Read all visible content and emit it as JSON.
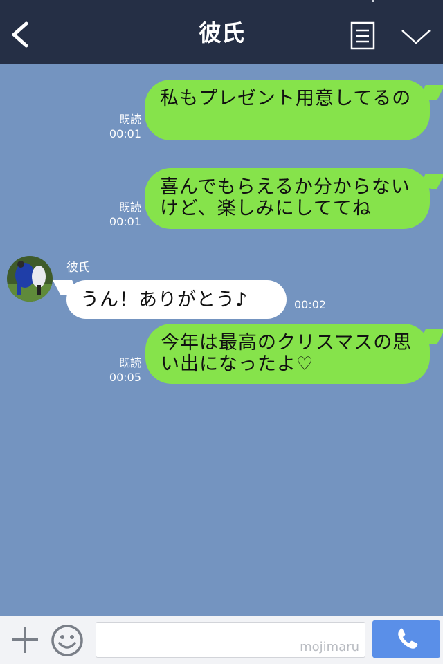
{
  "header": {
    "title": "彼氏",
    "back_icon": "chevron-left-icon",
    "notes_icon": "document-lines-icon",
    "menu_icon": "chevron-down-icon",
    "background": "#252f45"
  },
  "chat": {
    "background": "#7494c0",
    "messages": [
      {
        "from": "me",
        "text": "私もプレゼント用意してるの",
        "read": "既読",
        "time": "00:01"
      },
      {
        "from": "me",
        "text": "喜んでもらえるか分からないけど、楽しみにしててね",
        "read": "既読",
        "time": "00:01"
      },
      {
        "from": "them",
        "sender": "彼氏",
        "text": "うん！ありがとう♪",
        "time": "00:02"
      },
      {
        "from": "me",
        "text": "今年は最高のクリスマスの思い出になったよ♡",
        "read": "既読",
        "time": "00:05"
      }
    ]
  },
  "footer": {
    "plus_icon": "plus-icon",
    "emoji_icon": "smiley-icon",
    "input_value": "",
    "watermark": "mojimaru",
    "call_icon": "phone-icon"
  },
  "colors": {
    "my_bubble": "#86e34b",
    "their_bubble": "#ffffff",
    "call_button": "#5a8fe8"
  }
}
